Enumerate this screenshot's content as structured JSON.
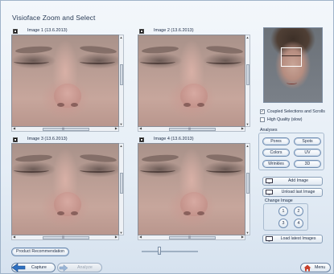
{
  "window": {
    "title": "Visioface Zoom and Select"
  },
  "panels": [
    {
      "label": "Image 1  (13.6.2013)"
    },
    {
      "label": "Image 2  (13.6.2013)"
    },
    {
      "label": "Image 3  (13.6.2013)"
    },
    {
      "label": "Image 4  (13.6.2013)"
    }
  ],
  "options": {
    "coupled": {
      "label": "Coupled Selections and Scrolls",
      "checked": true,
      "mark": "✓"
    },
    "high_quality": {
      "label": "High Quality (slow)",
      "checked": false
    }
  },
  "analyses": {
    "label": "Analyses",
    "buttons": [
      "Pores",
      "Spots",
      "Colors",
      "UV",
      "Wrinkles",
      "3D"
    ]
  },
  "actions": {
    "add_image": "Add Image",
    "unload_last": "Unload last Image",
    "load_latest": "Load latest Images"
  },
  "change_image": {
    "label": "Change Image",
    "buttons": [
      "1",
      "2",
      "3",
      "4"
    ]
  },
  "product_recommendation": "Product Recommendation",
  "bottom": {
    "capture": "Capture",
    "analyze": "Analyze",
    "menu": "Menu"
  },
  "colors": {
    "accent": "#2d6fc0",
    "panel_bg": "#e6eef6",
    "menu_icon": "#c8402c"
  },
  "icons": {
    "panel_select": "checkbox-square-icon",
    "add_image": "monitor-plus-icon",
    "unload_last": "monitor-minus-icon",
    "load_latest": "monitor-load-icon",
    "capture": "camera-arrow-icon",
    "analyze": "arrow-right-icon",
    "menu": "home-icon"
  }
}
